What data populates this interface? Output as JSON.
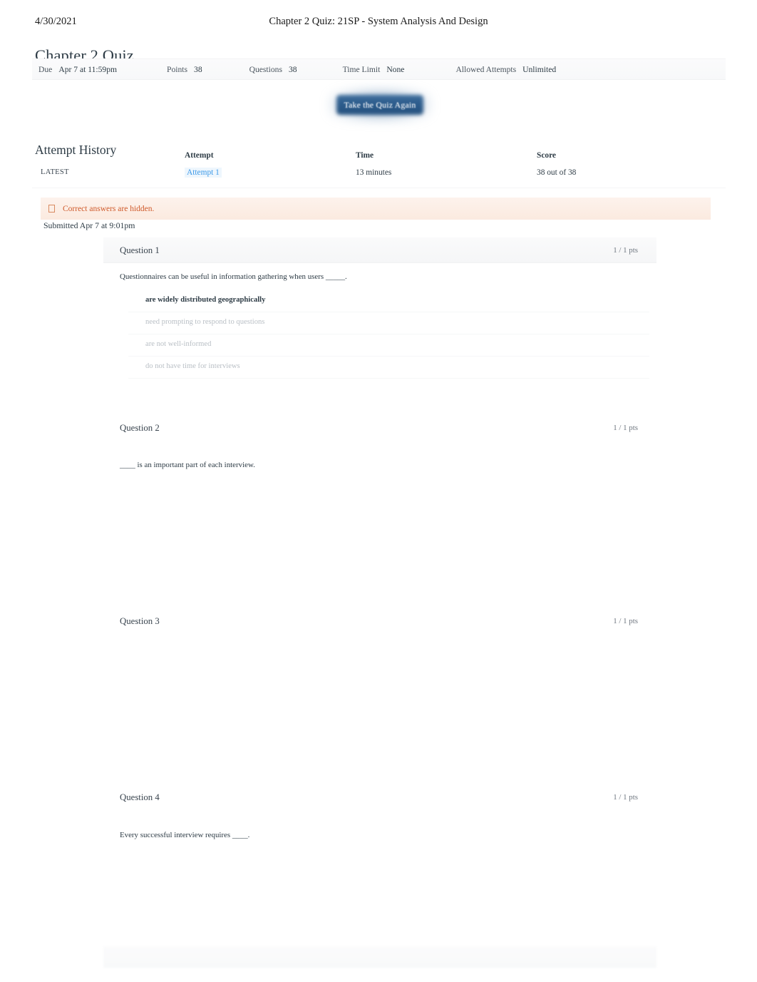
{
  "print_header": {
    "date": "4/30/2021",
    "document_title": "Chapter 2 Quiz: 21SP - System Analysis And Design"
  },
  "page_title": "Chapter 2 Quiz",
  "quiz_meta": [
    {
      "label": "Due",
      "value": "Apr 7 at 11:59pm"
    },
    {
      "label": "Points",
      "value": "38"
    },
    {
      "label": "Questions",
      "value": "38"
    },
    {
      "label": "Time Limit",
      "value": "None"
    },
    {
      "label": "Allowed Attempts",
      "value": "Unlimited"
    }
  ],
  "take_quiz_button": "Take the Quiz Again",
  "attempt_history": {
    "heading": "Attempt History",
    "columns": {
      "blank": "",
      "attempt": "Attempt",
      "time": "Time",
      "score": "Score"
    },
    "rows": [
      {
        "status": "LATEST",
        "attempt": "Attempt 1",
        "time": "13 minutes",
        "score": "38 out of 38"
      }
    ]
  },
  "banner": {
    "icon": "info-icon",
    "text": "Correct answers are hidden.",
    "color": "#cf5a2b",
    "background": "#fbeadf"
  },
  "submitted": "Submitted Apr 7 at 9:01pm",
  "questions": [
    {
      "title": "Question 1",
      "points": "1 / 1 pts",
      "prompt": "Questionnaires can be useful in information gathering when users _____.",
      "answers": [
        {
          "text": "are widely distributed geographically",
          "selected": true
        },
        {
          "text": "need prompting to respond to questions",
          "selected": false
        },
        {
          "text": "are not well-informed",
          "selected": false
        },
        {
          "text": "do not have time for interviews",
          "selected": false
        }
      ]
    },
    {
      "title": "Question 2",
      "points": "1 / 1 pts",
      "prompt": "____ is an important part of each interview.",
      "answers": []
    },
    {
      "title": "Question 3",
      "points": "1 / 1 pts",
      "prompt": "",
      "answers": []
    },
    {
      "title": "Question 4",
      "points": "1 / 1 pts",
      "prompt": "Every successful interview requires ____.",
      "answers": []
    }
  ]
}
